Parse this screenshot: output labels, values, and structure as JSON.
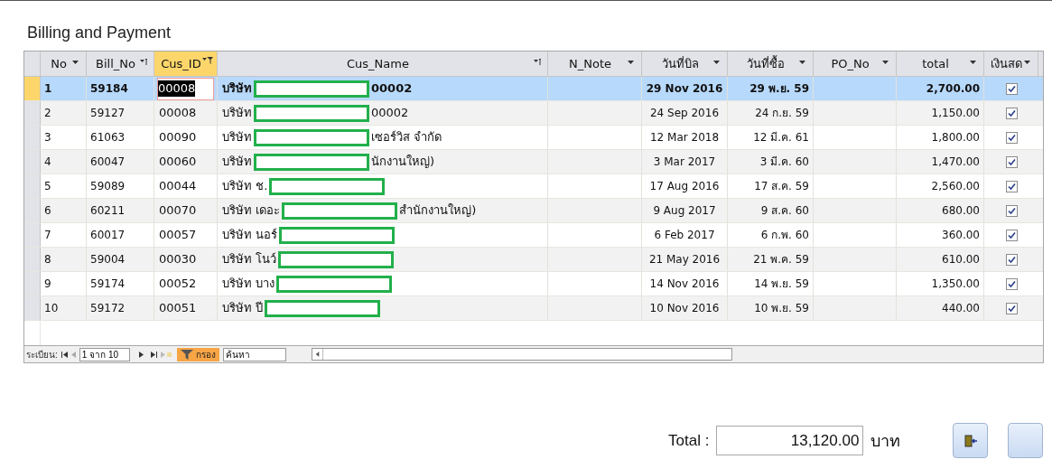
{
  "title": "Billing and Payment",
  "table": {
    "columns": [
      {
        "label": "No",
        "kind": "dropdown",
        "filtered": false
      },
      {
        "label": "Bill_No",
        "kind": "sort",
        "filtered": false
      },
      {
        "label": "Cus_ID",
        "kind": "filter",
        "filtered": true
      },
      {
        "label": "Cus_Name",
        "kind": "sort",
        "filtered": false
      },
      {
        "label": "N_Note",
        "kind": "dropdown",
        "filtered": false
      },
      {
        "label": "วันที่บิล",
        "kind": "dropdown",
        "filtered": false
      },
      {
        "label": "วันที่ซื้อ",
        "kind": "dropdown",
        "filtered": false
      },
      {
        "label": "PO_No",
        "kind": "dropdown",
        "filtered": false
      },
      {
        "label": "total",
        "kind": "dropdown",
        "filtered": false
      },
      {
        "label": "เงินสด",
        "kind": "dropdown",
        "filtered": false
      }
    ],
    "rows": [
      {
        "selected": true,
        "no": "1",
        "bill_no": "59184",
        "cus_id": "00008",
        "name_prefix": "บริษัท",
        "name_suffix": "00002",
        "bill_date": "29 Nov 2016",
        "buy_date": "29 พ.ย. 59",
        "total": "2,700.00",
        "cash": true
      },
      {
        "selected": false,
        "no": "2",
        "bill_no": "59127",
        "cus_id": "00008",
        "name_prefix": "บริษัท",
        "name_suffix": "00002",
        "bill_date": "24 Sep 2016",
        "buy_date": "24 ก.ย. 59",
        "total": "1,150.00",
        "cash": true
      },
      {
        "selected": false,
        "no": "3",
        "bill_no": "61063",
        "cus_id": "00090",
        "name_prefix": "บริษัท",
        "name_suffix": "เซอร์วิส จำกัด",
        "bill_date": "12 Mar 2018",
        "buy_date": "12 มี.ค. 61",
        "total": "1,800.00",
        "cash": true
      },
      {
        "selected": false,
        "no": "4",
        "bill_no": "60047",
        "cus_id": "00060",
        "name_prefix": "บริษัท",
        "name_suffix": "นักงานใหญ่)",
        "bill_date": "3 Mar 2017",
        "buy_date": "3 มี.ค. 60",
        "total": "1,470.00",
        "cash": true
      },
      {
        "selected": false,
        "no": "5",
        "bill_no": "59089",
        "cus_id": "00044",
        "name_prefix": "บริษัท ช.",
        "bill_date": "17 Aug 2016",
        "buy_date": "17 ส.ค. 59",
        "total": "2,560.00",
        "cash": true
      },
      {
        "selected": false,
        "no": "6",
        "bill_no": "60211",
        "cus_id": "00070",
        "name_prefix": "บริษัท เดอะ",
        "name_suffix": "สำนักงานใหญ่)",
        "bill_date": "9 Aug 2017",
        "buy_date": "9 ส.ค. 60",
        "total": "680.00",
        "cash": true
      },
      {
        "selected": false,
        "no": "7",
        "bill_no": "60017",
        "cus_id": "00057",
        "name_prefix": "บริษัท นอร์",
        "bill_date": "6 Feb 2017",
        "buy_date": "6 ก.พ. 60",
        "total": "360.00",
        "cash": true
      },
      {
        "selected": false,
        "no": "8",
        "bill_no": "59004",
        "cus_id": "00030",
        "name_prefix": "บริษัท โนว์",
        "bill_date": "21 May 2016",
        "buy_date": "21 พ.ค. 59",
        "total": "610.00",
        "cash": true
      },
      {
        "selected": false,
        "no": "9",
        "bill_no": "59174",
        "cus_id": "00052",
        "name_prefix": "บริษัท บาง",
        "bill_date": "14 Nov 2016",
        "buy_date": "14 พ.ย. 59",
        "total": "1,350.00",
        "cash": true
      },
      {
        "selected": false,
        "no": "10",
        "bill_no": "59172",
        "cus_id": "00051",
        "name_prefix": "บริษัท ปี",
        "bill_date": "10 Nov 2016",
        "buy_date": "10 พ.ย. 59",
        "total": "440.00",
        "cash": true
      }
    ]
  },
  "navigator": {
    "label": "ระเบียน:",
    "position": "1 จาก 10",
    "filter": "กรอง",
    "search_placeholder": "ค้นหา"
  },
  "footer": {
    "label": "Total :",
    "value": "13,120.00",
    "unit": "บาท"
  }
}
